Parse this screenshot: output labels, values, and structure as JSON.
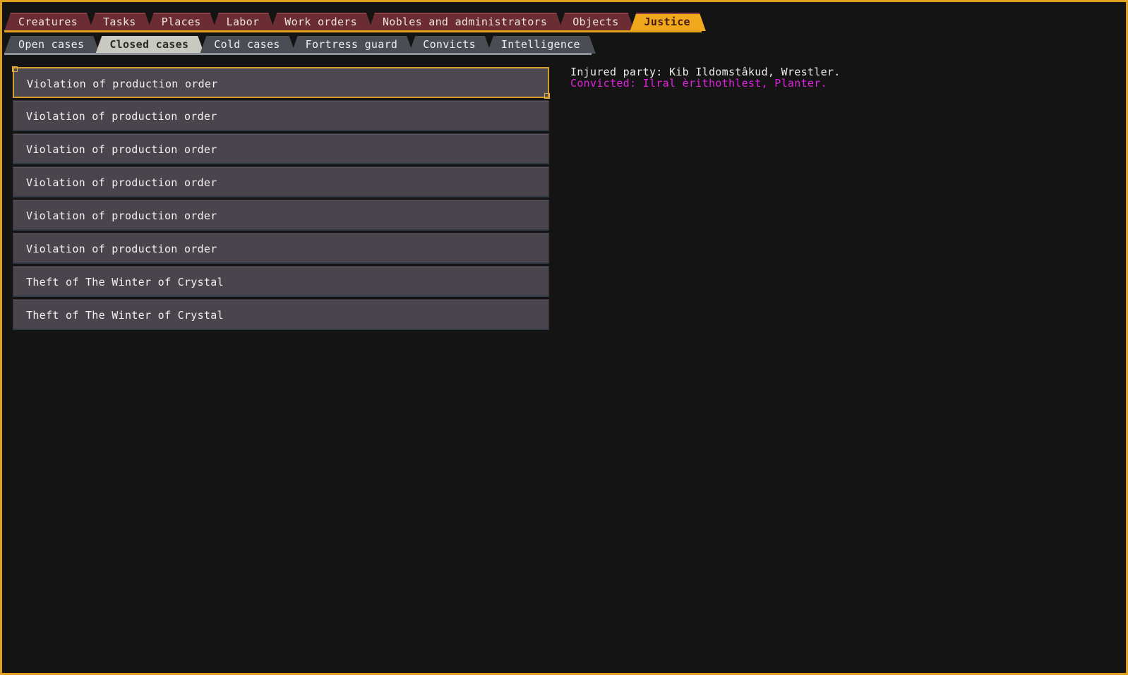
{
  "main_tabs": [
    {
      "label": "Creatures",
      "active": false
    },
    {
      "label": "Tasks",
      "active": false
    },
    {
      "label": "Places",
      "active": false
    },
    {
      "label": "Labor",
      "active": false
    },
    {
      "label": "Work orders",
      "active": false
    },
    {
      "label": "Nobles and administrators",
      "active": false
    },
    {
      "label": "Objects",
      "active": false
    },
    {
      "label": "Justice",
      "active": true
    }
  ],
  "sub_tabs": [
    {
      "label": "Open cases",
      "active": false
    },
    {
      "label": "Closed cases",
      "active": true
    },
    {
      "label": "Cold cases",
      "active": false
    },
    {
      "label": "Fortress guard",
      "active": false
    },
    {
      "label": "Convicts",
      "active": false
    },
    {
      "label": "Intelligence",
      "active": false
    }
  ],
  "cases": [
    {
      "label": "Violation of production order",
      "selected": true
    },
    {
      "label": "Violation of production order",
      "selected": false
    },
    {
      "label": "Violation of production order",
      "selected": false
    },
    {
      "label": "Violation of production order",
      "selected": false
    },
    {
      "label": "Violation of production order",
      "selected": false
    },
    {
      "label": "Violation of production order",
      "selected": false
    },
    {
      "label": "Theft of The Winter of Crystal",
      "selected": false
    },
    {
      "label": "Theft of The Winter of Crystal",
      "selected": false
    }
  ],
  "detail": {
    "injured_party": "Injured party: Kib Ildomstâkud, Wrestler.",
    "convicted": "Convicted: Ilral èrithothlest, Planter."
  },
  "colors": {
    "frame": "#e0a21c",
    "convicted_text": "#e020e0"
  }
}
